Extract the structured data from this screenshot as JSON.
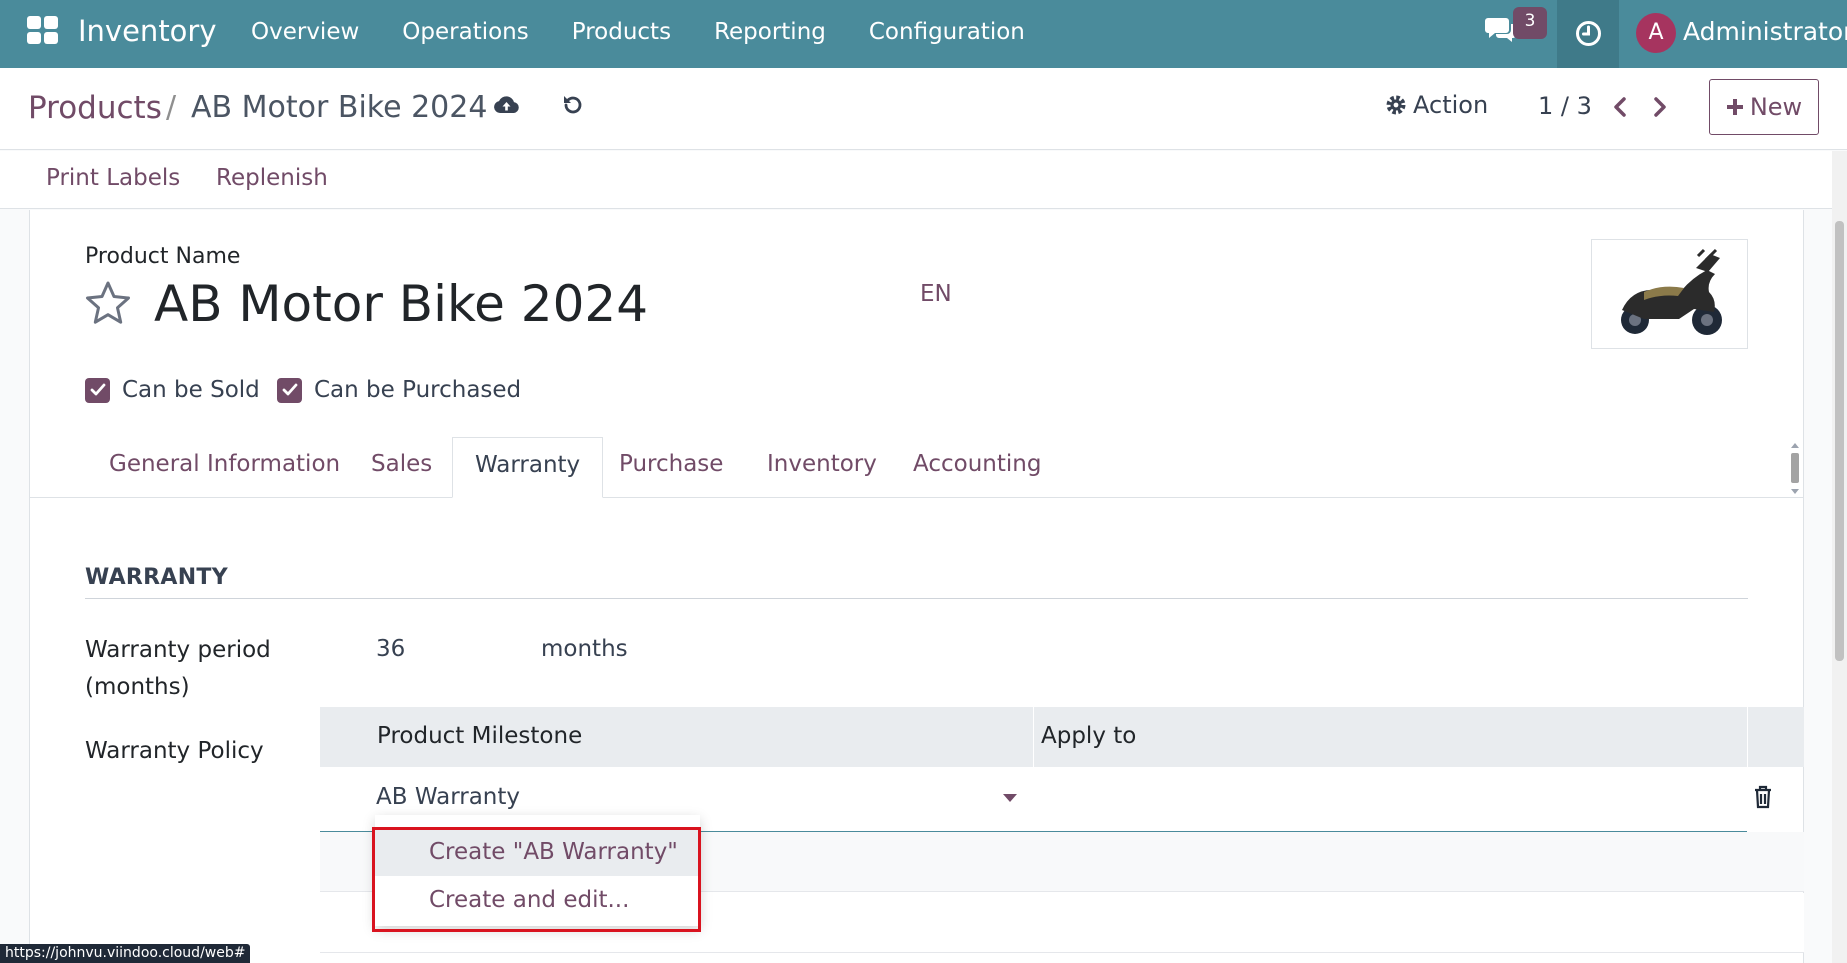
{
  "navbar": {
    "brand": "Inventory",
    "menu": [
      "Overview",
      "Operations",
      "Products",
      "Reporting",
      "Configuration"
    ],
    "chat_badge": "3",
    "avatar_letter": "A",
    "user": "Administrator",
    "color": "#4a8b9b"
  },
  "control": {
    "breadcrumb_parent": "Products",
    "breadcrumb_sep": "/",
    "breadcrumb_current": "AB Motor Bike 2024",
    "action_label": "Action",
    "pager": "1 / 3",
    "new_label": "New"
  },
  "statusbar": {
    "print_labels": "Print Labels",
    "replenish": "Replenish"
  },
  "form": {
    "product_name_label": "Product Name",
    "product_name": "AB Motor Bike 2024",
    "lang": "EN",
    "can_be_sold": "Can be Sold",
    "can_be_purchased": "Can be Purchased",
    "tabs": [
      "General Information",
      "Sales",
      "Warranty",
      "Purchase",
      "Inventory",
      "Accounting"
    ],
    "active_tab": "Warranty",
    "accent": "#714b67"
  },
  "warranty": {
    "section_title": "WARRANTY",
    "period_label": "Warranty period (months)",
    "period_value": "36",
    "period_unit": "months",
    "policy_label": "Warranty Policy",
    "col_milestone": "Product Milestone",
    "col_apply": "Apply to",
    "milestone_input": "AB Warranty"
  },
  "dropdown": {
    "create": "Create \"AB Warranty\"",
    "create_edit": "Create and edit..."
  },
  "url_tooltip": "https://johnvu.viindoo.cloud/web#"
}
